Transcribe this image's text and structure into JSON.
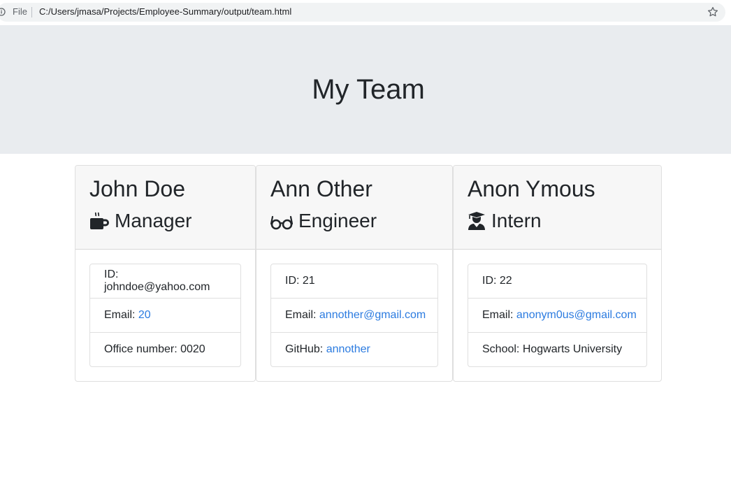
{
  "browser": {
    "file_label": "File",
    "url": "C:/Users/jmasa/Projects/Employee-Summary/output/team.html"
  },
  "header": {
    "title": "My Team"
  },
  "team": [
    {
      "name": "John Doe",
      "role": "Manager",
      "icon": "coffee-mug-icon",
      "id_line": "ID: johndoe@yahoo.com",
      "email_label": "Email: ",
      "email_value": "20",
      "extra_label": "Office number: 0020",
      "extra_value": ""
    },
    {
      "name": "Ann Other",
      "role": "Engineer",
      "icon": "glasses-icon",
      "id_line": "ID: 21",
      "email_label": "Email: ",
      "email_value": "annother@gmail.com",
      "extra_label": "GitHub: ",
      "extra_value": "annother"
    },
    {
      "name": "Anon Ymous",
      "role": "Intern",
      "icon": "graduate-icon",
      "id_line": "ID: 22",
      "email_label": "Email: ",
      "email_value": "anonym0us@gmail.com",
      "extra_label": "School: Hogwarts University",
      "extra_value": ""
    }
  ],
  "colors": {
    "link": "#2b7be0",
    "jumbotron_bg": "#e9ecef",
    "card_header_bg": "#f7f7f7"
  }
}
